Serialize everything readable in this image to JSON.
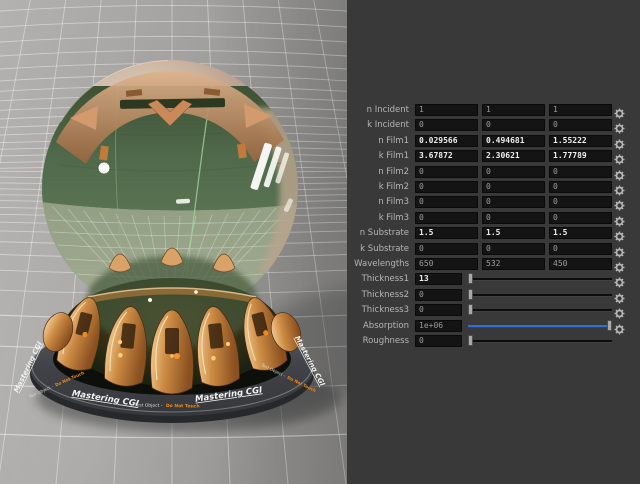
{
  "scene": {
    "base_ring": {
      "logo": "Mastering CGI",
      "warning_prefix": "Test Object -",
      "warning_emphasis": "Do Not Touch"
    },
    "colors": {
      "sphere_green": "#557050",
      "copper": "#c98a4b",
      "backdrop_gray": "#a3a3a1"
    }
  },
  "panel": {
    "accent_blue": "#2e6fd6",
    "rows": [
      {
        "label": "n Incident",
        "values": [
          "1",
          "1",
          "1"
        ],
        "bold": false,
        "gear": true
      },
      {
        "label": "k Incident",
        "values": [
          "0",
          "0",
          "0"
        ],
        "bold": false,
        "gear": true
      },
      {
        "label": "n Film1",
        "values": [
          "0.029566",
          "0.494681",
          "1.55222"
        ],
        "bold": true,
        "gear": true
      },
      {
        "label": "k Film1",
        "values": [
          "3.67872",
          "2.30621",
          "1.77789"
        ],
        "bold": true,
        "gear": true
      },
      {
        "label": "n Film2",
        "values": [
          "0",
          "0",
          "0"
        ],
        "bold": false,
        "gear": true
      },
      {
        "label": "k Film2",
        "values": [
          "0",
          "0",
          "0"
        ],
        "bold": false,
        "gear": true
      },
      {
        "label": "n Film3",
        "values": [
          "0",
          "0",
          "0"
        ],
        "bold": false,
        "gear": true
      },
      {
        "label": "k Film3",
        "values": [
          "0",
          "0",
          "0"
        ],
        "bold": false,
        "gear": true
      },
      {
        "label": "n Substrate",
        "values": [
          "1.5",
          "1.5",
          "1.5"
        ],
        "bold": true,
        "gear": true
      },
      {
        "label": "k Substrate",
        "values": [
          "0",
          "0",
          "0"
        ],
        "bold": false,
        "gear": true
      },
      {
        "label": "Wavelengths",
        "values": [
          "650",
          "532",
          "450"
        ],
        "bold": false,
        "gear": true
      },
      {
        "label": "Thickness1",
        "values": [
          "13"
        ],
        "bold": true,
        "gear": true,
        "slider": {
          "pos": 0,
          "blue": false
        }
      },
      {
        "label": "Thickness2",
        "values": [
          "0"
        ],
        "bold": false,
        "gear": true,
        "slider": {
          "pos": 0,
          "blue": false
        }
      },
      {
        "label": "Thickness3",
        "values": [
          "0"
        ],
        "bold": false,
        "gear": true,
        "slider": {
          "pos": 0,
          "blue": false
        }
      },
      {
        "label": "Absorption",
        "values": [
          "1e+06"
        ],
        "bold": false,
        "gear": true,
        "slider": {
          "pos": 1,
          "blue": true
        }
      },
      {
        "label": "Roughness",
        "values": [
          "0"
        ],
        "bold": false,
        "gear": false,
        "slider": {
          "pos": 0,
          "blue": false
        }
      }
    ]
  }
}
